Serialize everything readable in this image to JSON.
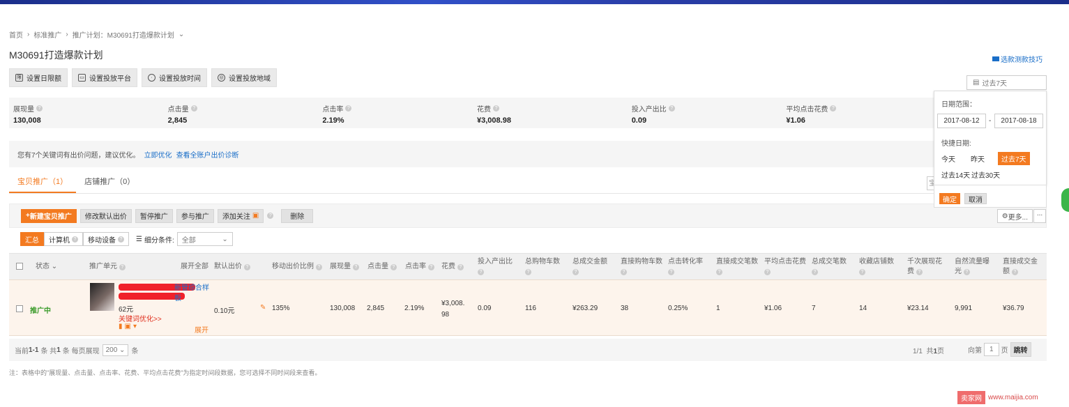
{
  "breadcrumb": {
    "home": "首页",
    "level2": "标准推广",
    "level3": "推广计划：M30691打造爆款计划"
  },
  "page": {
    "title": "M30691打造爆款计划",
    "video_link": "选款测款技巧"
  },
  "settings_buttons": [
    "设置日限额",
    "设置投放平台",
    "设置投放时间",
    "设置投放地域"
  ],
  "date_trigger": "过去7天",
  "stats": [
    {
      "label": "展现量",
      "value": "130,008"
    },
    {
      "label": "点击量",
      "value": "2,845"
    },
    {
      "label": "点击率",
      "value": "2.19%"
    },
    {
      "label": "花费",
      "value": "¥3,008.98"
    },
    {
      "label": "投入产出比",
      "value": "0.09"
    },
    {
      "label": "平均点击花费",
      "value": "¥1.06"
    }
  ],
  "notice": {
    "text": "您有7个关键词有出价问题，建议优化。",
    "link1": "立即优化",
    "link2": "查看全账户出价诊断"
  },
  "tabs": [
    "宝贝推广（1）",
    "店铺推广（0）"
  ],
  "tabs_right_placeholder": "宝",
  "toolbar": {
    "new": "新建宝贝推广",
    "modify": "修改默认出价",
    "pause": "暂停推广",
    "join": "参与推广",
    "follow": "添加关注",
    "delete": "删除",
    "more": "更多...",
    "dots": "..."
  },
  "filter": {
    "summary": "汇总",
    "computer": "计算机",
    "mobile": "移动设备",
    "label": "细分条件:",
    "select": "全部"
  },
  "table": {
    "headers": [
      "状态",
      "推广单元",
      "展开全部",
      "默认出价",
      "移动出价比例",
      "展现量",
      "点击量",
      "点击率",
      "花费",
      "投入产出比",
      "总购物车数",
      "总成交金额",
      "直接购物车数",
      "点击转化率",
      "直接成交笔数",
      "平均点击花费",
      "总成交笔数",
      "收藏店铺数",
      "千次展现花费",
      "自然流量曝光",
      "直接成交金额"
    ],
    "row": {
      "status": "推广中",
      "title_visible": "新管综合样板",
      "price": "62元",
      "optimize": "关键词优化>>",
      "expand": "展开",
      "bid": "0.10元",
      "mobile_ratio": "135%",
      "impressions": "130,008",
      "clicks": "2,845",
      "ctr": "2.19%",
      "cost_line1": "¥3,008.",
      "cost_line2": "98",
      "roi": "0.09",
      "cart_total": "116",
      "gmv": "¥263.29",
      "cart_direct": "38",
      "cvr": "0.25%",
      "orders_direct": "1",
      "cpc": "¥1.06",
      "orders_total": "7",
      "fav_shop": "14",
      "cpm": "¥23.14",
      "natural": "9,991",
      "gmv_direct": "¥36.79"
    }
  },
  "pager": {
    "current": "当前",
    "range": "1-1",
    "items": "条 共",
    "total": "1",
    "items2": "条 每页展现",
    "page_size": "200",
    "unit": "条",
    "page_info": "1/1",
    "total_pages_prefix": "共",
    "total_pages": "1",
    "page_suffix": "页",
    "goto": "向第",
    "goto_val": "1",
    "goto_suffix": "页",
    "jump": "跳转"
  },
  "note": "注：表格中的\"展现量、点击量、点击率、花费、平均点击花费\"为指定时间段数据，您可选择不同时间段来查看。",
  "date_popup": {
    "range_label": "日期范围：",
    "start": "2017-08-12",
    "sep": "-",
    "end": "2017-08-18",
    "quick_label": "快捷日期:",
    "today": "今天",
    "yesterday": "昨天",
    "last7": "过去7天",
    "last14": "过去14天",
    "last30": "过去30天",
    "ok": "确定",
    "cancel": "取消"
  },
  "watermark": {
    "logo": "卖家网",
    "url": "www.maijia.com"
  },
  "colors": {
    "accent": "#f37a20",
    "link": "#1a6ec8",
    "status_green": "#3a9b2a",
    "top_bar": "#2a3ea8"
  }
}
